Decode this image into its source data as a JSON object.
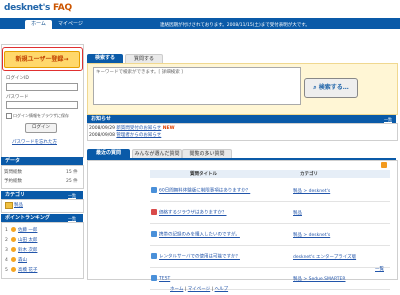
{
  "app": {
    "logo_main": "desknet's",
    "logo_faq": "FAQ"
  },
  "nav": {
    "home": "ホーム",
    "mypage": "マイページ"
  },
  "welcome": "連絡因期が付けされております。2008/11/15(土)まで受付表明が大です。",
  "left": {
    "new_user_button": "新規ユーザー登録→",
    "login_id_label": "ログインID",
    "password_label": "パスワード",
    "remember_label": "ログイン情報をブラウザに保存",
    "login_button": "ログイン",
    "forgot_link": "パスワードを忘れた方",
    "data_header": "データ",
    "data_rows": [
      {
        "label": "質問総数",
        "value": "15 件"
      },
      {
        "label": "予約総数",
        "value": "25 件"
      }
    ],
    "category_header": "カテゴリ",
    "category_more": "一覧",
    "category_item": "製品",
    "ranking_header": "ポイントランキング",
    "ranking_more": "一覧",
    "ranking": [
      {
        "rank": "1",
        "name": "佐藤 一郎"
      },
      {
        "rank": "2",
        "name": "山田 太郎"
      },
      {
        "rank": "3",
        "name": "鈴木 次郎"
      },
      {
        "rank": "4",
        "name": "森山"
      },
      {
        "rank": "5",
        "name": "高橋 花子"
      }
    ]
  },
  "search": {
    "tab_search": "検索する",
    "tab_ask": "質問する",
    "placeholder": "キーワードで検索ができます。[ 詳細検索 ]",
    "button": "検索する…"
  },
  "news": {
    "header": "お知らせ",
    "more": "一覧",
    "items": [
      {
        "date": "2008/09/29",
        "title": "新質問受付のお知らせ",
        "badge": "NEW"
      },
      {
        "date": "2008/09/08",
        "title": "管理者からのお知らせ"
      }
    ]
  },
  "questions": {
    "tabs": [
      "最近の質問",
      "みんなが選んだ質問",
      "閲覧の多い質問"
    ],
    "col_title": "質問タイトル",
    "col_category": "カテゴリ",
    "more": "一覧",
    "rows": [
      {
        "title": "60日間無料体験版に制限事項はありますか？",
        "category": "製品 > desknet's"
      },
      {
        "title": "価格するジラウザはありますか？",
        "category": "製品"
      },
      {
        "title": "携帯の記録のみを購入したいのですが。",
        "category": "製品 > desknet's"
      },
      {
        "title": "レンタルサーバでの使用は可能ですか？",
        "category": "desknet's エンタープライズ版"
      },
      {
        "title": "TEST",
        "category": "製品 > Sedue.SMARTER"
      }
    ]
  },
  "footer": {
    "home": "ホーム",
    "mypage": "マイページ",
    "help": "ヘルプ"
  },
  "colors": {
    "primary": "#0a5aa8",
    "accent": "#ffd86b",
    "search_bg": "#fff6d5"
  }
}
